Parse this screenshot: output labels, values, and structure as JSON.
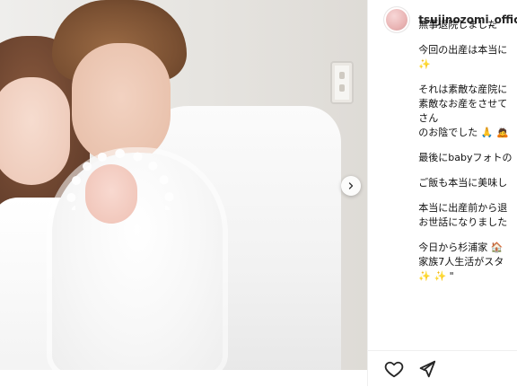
{
  "post": {
    "account": {
      "username": "tsujinozomi_official",
      "avatar_icon": "profile-avatar"
    },
    "caption_lines": [
      "無事退院しました",
      "",
      "今回の出産は本当に",
      "✨",
      "",
      "それは素敵な産院に",
      "素敵なお産をさせて",
      "さん",
      "のお陰でした 🙏 🙇",
      "",
      "最後にbabyフォトの",
      "",
      "ご飯も本当に美味し",
      "",
      "本当に出産前から退",
      "お世話になりました",
      "",
      "今日から杉浦家 🏠",
      "家族7人生活がスタ",
      "✨ ✨ \""
    ],
    "actions": {
      "like_icon": "heart-icon",
      "share_icon": "send-icon"
    },
    "carousel": {
      "next_icon": "chevron-right-icon"
    }
  }
}
